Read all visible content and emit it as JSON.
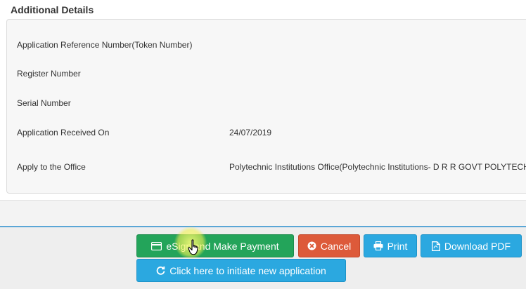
{
  "section": {
    "title": "Additional Details"
  },
  "details": {
    "ref_label": "Application Reference Number(Token Number)",
    "ref_value": "",
    "register_label": "Register Number",
    "register_value": "",
    "serial_label": "Serial Number",
    "serial_value": "",
    "received_label": "Application Received On",
    "received_value": "24/07/2019",
    "office_label": "Apply to the Office",
    "office_value": "Polytechnic Institutions Office(Polytechnic Institutions- D R R GOVT POLYTECH"
  },
  "actions": {
    "esign_label": "eSign and Make Payment",
    "cancel_label": "Cancel",
    "print_label": "Print",
    "pdf_label": "Download PDF",
    "new_app_label": "Click here to initiate new application"
  },
  "icons": {
    "esign": "credit-card-icon",
    "cancel": "times-circle-icon",
    "print": "print-icon",
    "pdf": "file-pdf-icon",
    "new_app": "refresh-icon"
  },
  "colors": {
    "primary_green": "#23a45a",
    "danger_red": "#dd5a3a",
    "info_blue": "#2ba8e0",
    "divider_blue": "#5aa6d6"
  }
}
